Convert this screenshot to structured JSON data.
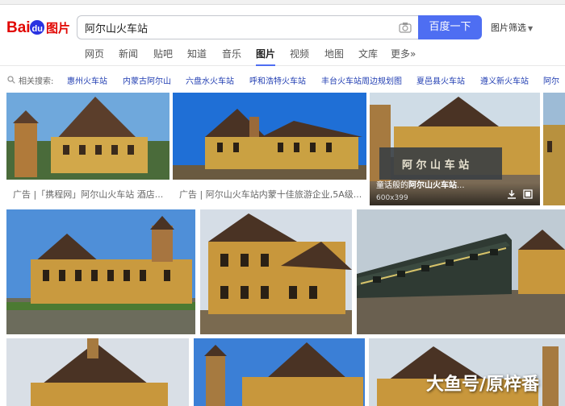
{
  "header": {
    "logo_text": "Baidu图片",
    "search_value": "阿尔山火车站",
    "search_button": "百度一下",
    "filter_link": "图片筛选"
  },
  "tabs": [
    {
      "label": "网页",
      "active": false
    },
    {
      "label": "新闻",
      "active": false
    },
    {
      "label": "贴吧",
      "active": false
    },
    {
      "label": "知道",
      "active": false
    },
    {
      "label": "音乐",
      "active": false
    },
    {
      "label": "图片",
      "active": true
    },
    {
      "label": "视频",
      "active": false
    },
    {
      "label": "地图",
      "active": false
    },
    {
      "label": "文库",
      "active": false
    },
    {
      "label": "更多»",
      "active": false
    }
  ],
  "related": {
    "label": "相关搜索:",
    "items": [
      "惠州火车站",
      "内蒙古阿尔山",
      "六盘水火车站",
      "呼和浩特火车站",
      "丰台火车站周边规划图",
      "夏邑县火车站",
      "遵义新火车站",
      "阿尔"
    ]
  },
  "results": {
    "row1": [
      {
        "caption": "广告 |「携程网」阿尔山火车站 酒店..."
      },
      {
        "caption": "广告 | 阿尔山火车站内蒙十佳旅游企业,5A级..."
      },
      {
        "overlay_title_prefix": "童话般的",
        "overlay_title_highlight": "阿尔山火车站",
        "overlay_title_suffix": "...",
        "overlay_dim": "600x399"
      }
    ]
  },
  "watermark": "大鱼号/原梓番",
  "colors": {
    "accent": "#4e6ef2",
    "link": "#2440b3"
  }
}
